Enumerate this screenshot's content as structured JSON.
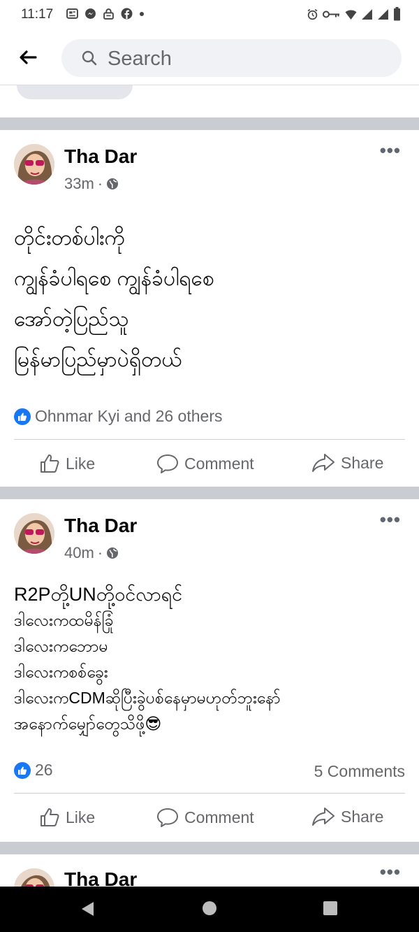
{
  "status_bar": {
    "time": "11:17",
    "left_icons": [
      "news-icon",
      "messenger-icon",
      "lock-icon",
      "facebook-icon",
      "dot-icon"
    ],
    "right_icons": [
      "alarm-icon",
      "key-icon",
      "wifi-icon",
      "signal-icon",
      "signal-icon",
      "battery-icon"
    ]
  },
  "header": {
    "back_icon": "arrow-left-icon",
    "search": {
      "placeholder": "Search",
      "icon": "search-icon"
    }
  },
  "posts": [
    {
      "author": "Tha Dar",
      "time": "33m",
      "privacy_icon": "globe-icon",
      "more_label": "•••",
      "body_lines": [
        "တိုင်းတစ်ပါးကို",
        "ကျွန်ခံပါရစေ  ကျွန်ခံပါရစေ",
        "အော်တဲ့ပြည်သူ",
        "မြန်မာပြည်မှာပဲရှိတယ်"
      ],
      "reactions_text": "Ohnmar Kyi and 26 others",
      "comments_text": "",
      "actions": {
        "like": "Like",
        "comment": "Comment",
        "share": "Share"
      }
    },
    {
      "author": "Tha Dar",
      "time": "40m",
      "privacy_icon": "globe-icon",
      "more_label": "•••",
      "body_lines": [
        "R2Pတို့UNတို့ဝင်လာရင်",
        "ဒါလေးကထမိန်ခြုံ",
        "ဒါလေးကဘောမ",
        "ဒါလေးကစစ်ခွေး",
        "ဒါလေးကCDMဆိုပြီးခွဲပစ်နေမှာမဟုတ်ဘူးနော်",
        "အနောက်မျှော်တွေသိဖို့😎"
      ],
      "reactions_text": "26",
      "comments_text": "5 Comments",
      "actions": {
        "like": "Like",
        "comment": "Comment",
        "share": "Share"
      }
    },
    {
      "author": "Tha Dar",
      "more_label": "•••"
    }
  ],
  "nav_bar": {
    "back_icon": "triangle-back-icon",
    "home_icon": "circle-home-icon",
    "recents_icon": "square-recents-icon"
  },
  "colors": {
    "brand_blue": "#1877f2",
    "text_primary": "#050505",
    "text_secondary": "#65676b",
    "divider": "#c9ccd1",
    "search_bg": "#f0f2f5"
  }
}
